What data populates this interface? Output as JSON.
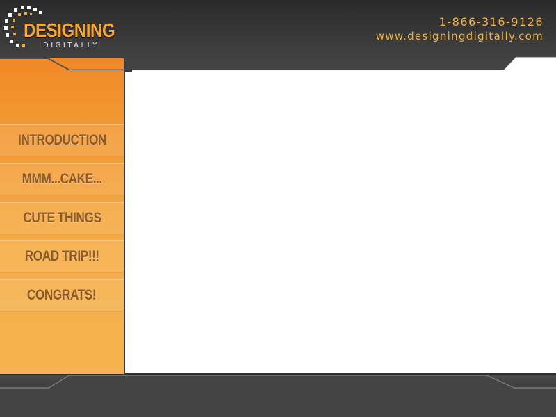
{
  "brand": {
    "name_line1": "DESIGNING",
    "name_line2": "DIGITALLY",
    "logo_icon": "dotted-circle-logo"
  },
  "contact": {
    "phone": "1-866-316-9126",
    "website": "www.designingdigitally.com"
  },
  "sidebar": {
    "items": [
      {
        "label": "INTRODUCTION"
      },
      {
        "label": "MMM...CAKE..."
      },
      {
        "label": "CUTE THINGS"
      },
      {
        "label": "ROAD TRIP!!!"
      },
      {
        "label": "CONGRATS!"
      }
    ]
  },
  "colors": {
    "accent_orange": "#f39a35",
    "nav_text": "#8a5a2a",
    "header_dark": "#3a3a3a",
    "contact_text": "#f0b23a"
  }
}
